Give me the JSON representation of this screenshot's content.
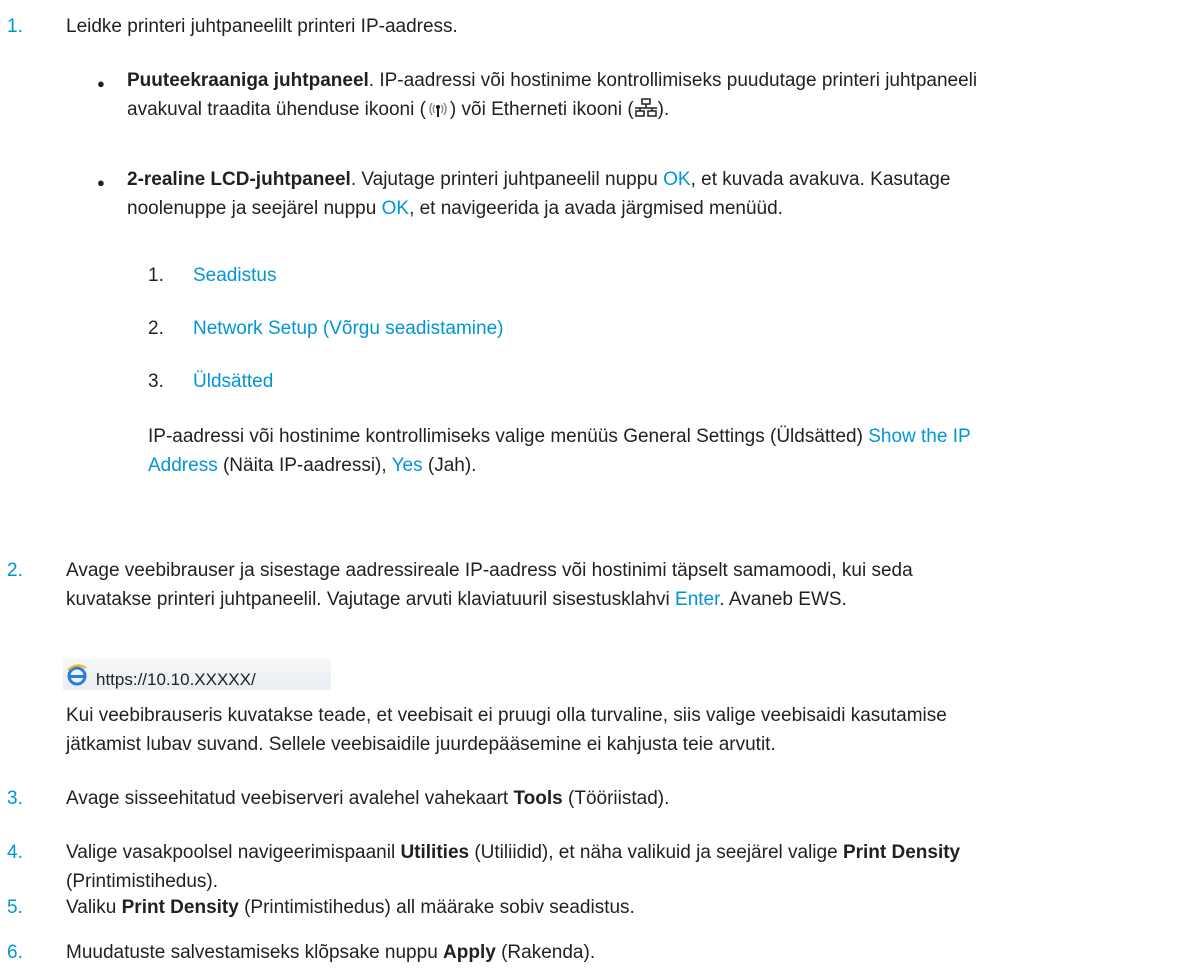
{
  "steps": [
    {
      "num": "1.",
      "text": "Leidke printeri juhtpaneelilt printeri IP-aadress."
    },
    {
      "num": "2.",
      "text_a": "Avage veebibrauser ja sisestage aadressireale IP-aadress või hostinimi täpselt samamoodi, kui seda",
      "text_b_1": "kuvatakse printeri juhtpaneelil. Vajutage arvuti klaviatuuril sisestusklahvi ",
      "text_b_key": "Enter",
      "text_b_2": ". Avaneb EWS."
    },
    {
      "num": "3.",
      "pre": "Avage sisseehitatud veebiserveri avalehel vahekaart ",
      "bold": "Tools",
      "post": " (Tööriistad)."
    },
    {
      "num": "4.",
      "pre": "Valige vasakpoolsel navigeerimispaanil ",
      "bold1": "Utilities",
      "mid": " (Utiliidid), et näha valikuid ja seejärel valige ",
      "bold2": "Print Density",
      "line2": "(Printimistihedus)."
    },
    {
      "num": "5.",
      "pre": "Valiku ",
      "bold": "Print Density",
      "post": " (Printimistihedus) all määrake sobiv seadistus."
    },
    {
      "num": "6.",
      "pre": "Muudatuste salvestamiseks klõpsake nuppu ",
      "bold": "Apply",
      "post": " (Rakenda)."
    }
  ],
  "bullets": [
    {
      "symbol": "●",
      "title": "Puuteekraaniga juhtpaneel",
      "line1": ". IP-aadressi või hostinime kontrollimiseks puudutage printeri juhtpaneeli",
      "line2_a": "avakuval traadita ühenduse ikooni (",
      "line2_b": ") või Etherneti ikooni (",
      "line2_c": ")."
    },
    {
      "symbol": "●",
      "title": "2-realine LCD-juhtpaneel",
      "line1_a": ". Vajutage printeri juhtpaneelil nuppu ",
      "ok": "OK",
      "line1_b": ", et kuvada avakuva. Kasutage",
      "line2_a": "noolenuppe ja seejärel nuppu ",
      "line2_b": ", et navigeerida ja avada järgmised menüüd."
    }
  ],
  "menus": [
    {
      "num": "1.",
      "label": "Seadistus"
    },
    {
      "num": "2.",
      "label": "Network Setup (Võrgu seadistamine)"
    },
    {
      "num": "3.",
      "label": "Üldsätted"
    }
  ],
  "ip_note": {
    "a": "IP-aadressi või hostinime kontrollimiseks valige menüüs General Settings (Üldsätted) ",
    "link1": "Show the IP",
    "link1b": "Address",
    "b": " (Näita IP-aadressi), ",
    "link2": "Yes",
    "c": " (Jah)."
  },
  "address_bar": {
    "url": "https://10.10.XXXXX/",
    "icon": "internet-explorer-icon"
  },
  "security_note": {
    "line1": "Kui veebibrauseris kuvatakse teade, et veebisait ei pruugi olla turvaline, siis valige veebisaidi kasutamise",
    "line2": "jätkamist lubav suvand. Sellele veebisaidile juurdepääsemine ei kahjusta teie arvutit."
  },
  "colors": {
    "accent": "#0096d6",
    "text": "#231f20"
  }
}
